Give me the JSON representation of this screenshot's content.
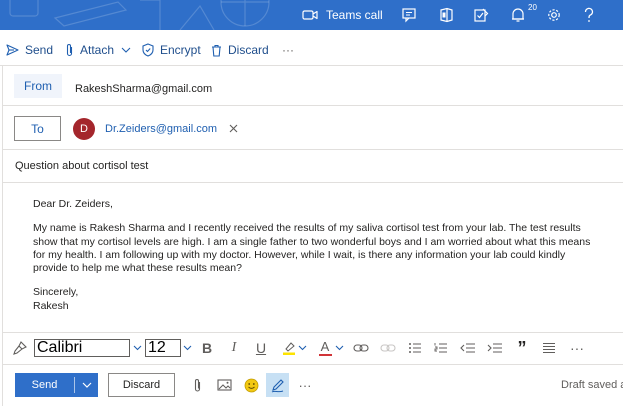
{
  "topbar": {
    "teams_call_label": "Teams call",
    "notification_count": "20",
    "icons": [
      "video-camera-icon",
      "chat-icon",
      "office-icon",
      "checklist-icon",
      "bell-icon",
      "gear-icon",
      "help-icon"
    ],
    "background": "#2f6fc9"
  },
  "commands": {
    "send": "Send",
    "attach": "Attach",
    "encrypt": "Encrypt",
    "discard": "Discard",
    "more": "···"
  },
  "compose": {
    "from_label": "From",
    "from_address": "RakeshSharma@gmail.com",
    "to_label": "To",
    "recipient_initial": "D",
    "recipient_address": "Dr.Zeiders@gmail.com",
    "subject": "Question about cortisol test"
  },
  "message": {
    "greeting": "Dear Dr. Zeiders,",
    "paragraph": "My name is Rakesh Sharma and I recently received the results of my saliva cortisol test from your lab. The test results show that my cortisol levels are high. I am a single father to two wonderful boys and I am worried about what this means for my health. I am following up with my doctor. However, while I wait, is there any information your lab could kindly provide to help me what these results mean?",
    "closing": "Sincerely,",
    "signature": "Rakesh"
  },
  "format_bar": {
    "font": "Calibri",
    "size": "12",
    "bold": "B",
    "italic": "I",
    "underline": "U",
    "font_color": "A",
    "quote": "”",
    "more": "···"
  },
  "footer": {
    "send": "Send",
    "discard": "Discard",
    "more": "···",
    "status": "Draft saved at"
  },
  "colors": {
    "accent": "#2f6fc9",
    "link": "#1f5fb0",
    "avatar": "#a4262c",
    "highlight": "#fde300",
    "font_color_bar": "#d13438"
  }
}
